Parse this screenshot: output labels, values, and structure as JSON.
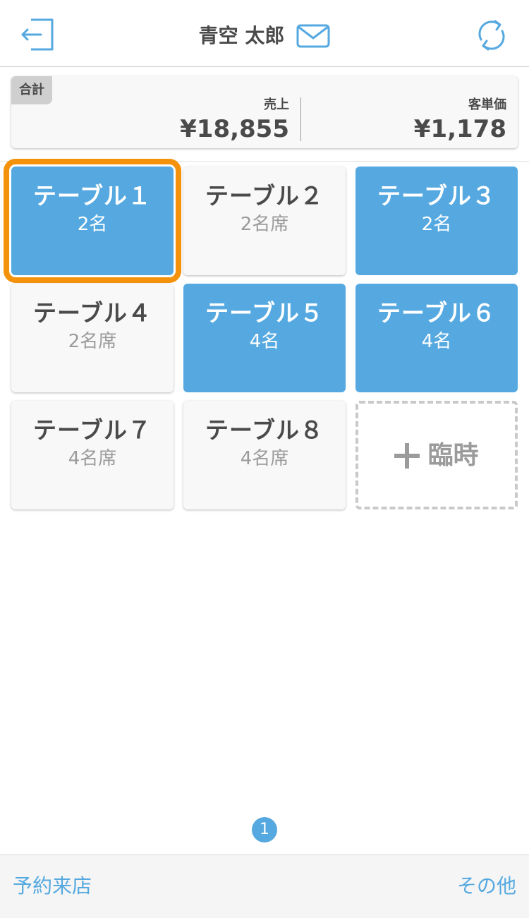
{
  "header": {
    "user_name": "青空 太郎",
    "logout_icon": "logout-icon",
    "mail_icon": "mail-icon",
    "refresh_icon": "refresh-icon"
  },
  "summary": {
    "tag": "合計",
    "sales_label": "売上",
    "sales_value": "¥18,855",
    "avg_label": "客単価",
    "avg_value": "¥1,178"
  },
  "tables": [
    {
      "name": "テーブル１",
      "info": "2名",
      "state": "occupied",
      "selected": true
    },
    {
      "name": "テーブル２",
      "info": "2名席",
      "state": "empty",
      "selected": false
    },
    {
      "name": "テーブル３",
      "info": "2名",
      "state": "occupied",
      "selected": false
    },
    {
      "name": "テーブル４",
      "info": "2名席",
      "state": "empty",
      "selected": false
    },
    {
      "name": "テーブル５",
      "info": "4名",
      "state": "occupied",
      "selected": false
    },
    {
      "name": "テーブル６",
      "info": "4名",
      "state": "occupied",
      "selected": false
    },
    {
      "name": "テーブル７",
      "info": "4名席",
      "state": "empty",
      "selected": false
    },
    {
      "name": "テーブル８",
      "info": "4名席",
      "state": "empty",
      "selected": false
    }
  ],
  "add_tile": {
    "label": "臨時",
    "icon": "plus-icon"
  },
  "pagination": {
    "current": "1"
  },
  "footer": {
    "left_link": "予約来店",
    "right_link": "その他"
  },
  "colors": {
    "accent": "#55a9e0",
    "selected_outline": "#f4930b",
    "text": "#4a4a4a",
    "muted": "#9b9b9b"
  }
}
